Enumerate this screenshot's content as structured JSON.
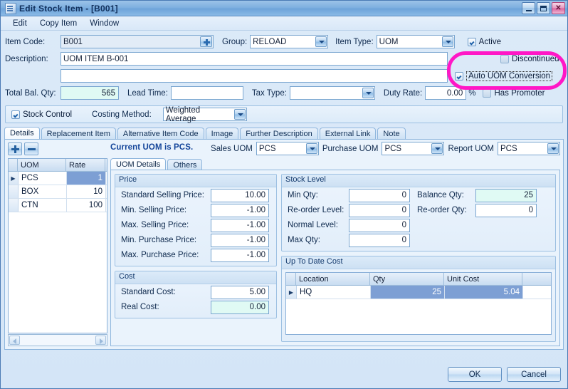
{
  "window": {
    "title": "Edit Stock Item - [B001]",
    "icon": "stock-item-icon",
    "minimize": "–",
    "maximize": "□",
    "close": "✕"
  },
  "menu": {
    "items": [
      "Edit",
      "Copy Item",
      "Window"
    ]
  },
  "header": {
    "item_code_label": "Item Code:",
    "item_code_value": "B001",
    "group_label": "Group:",
    "group_value": "RELOAD",
    "item_type_label": "Item Type:",
    "item_type_value": "UOM",
    "active_label": "Active",
    "active_checked": true,
    "description_label": "Description:",
    "description_value": "UOM ITEM B-001",
    "description2_value": "",
    "discontinued_label": "Discontinued",
    "discontinued_checked": false,
    "auto_uom_label": "Auto UOM Conversion",
    "auto_uom_checked": true,
    "has_promoter_label": "Has Promoter",
    "has_promoter_checked": false,
    "total_bal_label": "Total Bal. Qty:",
    "total_bal_value": "565",
    "lead_time_label": "Lead Time:",
    "lead_time_value": "",
    "tax_type_label": "Tax Type:",
    "tax_type_value": "",
    "duty_rate_label": "Duty Rate:",
    "duty_rate_value": "0.00",
    "duty_rate_suffix": "%",
    "stock_control_label": "Stock Control",
    "stock_control_checked": true,
    "costing_method_label": "Costing Method:",
    "costing_method_value": "Weighted Average"
  },
  "tabs": [
    {
      "label": "Details",
      "active": true
    },
    {
      "label": "Replacement Item",
      "active": false
    },
    {
      "label": "Alternative Item Code",
      "active": false
    },
    {
      "label": "Image",
      "active": false
    },
    {
      "label": "Further Description",
      "active": false
    },
    {
      "label": "External Link",
      "active": false
    },
    {
      "label": "Note",
      "active": false
    }
  ],
  "details": {
    "add_button": "add-uom",
    "remove_button": "remove-uom",
    "current_uom_text": "Current UOM is PCS.",
    "sales_uom_label": "Sales UOM",
    "sales_uom_value": "PCS",
    "purchase_uom_label": "Purchase UOM",
    "purchase_uom_value": "PCS",
    "report_uom_label": "Report UOM",
    "report_uom_value": "PCS",
    "uom_grid": {
      "columns": [
        "UOM",
        "Rate"
      ],
      "rows": [
        {
          "uom": "PCS",
          "rate": "1",
          "selected": true
        },
        {
          "uom": "BOX",
          "rate": "10",
          "selected": false
        },
        {
          "uom": "CTN",
          "rate": "100",
          "selected": false
        }
      ]
    },
    "subtabs": [
      {
        "label": "UOM Details",
        "active": true
      },
      {
        "label": "Others",
        "active": false
      }
    ],
    "price": {
      "title": "Price",
      "fields": [
        {
          "label": "Standard Selling Price:",
          "value": "10.00"
        },
        {
          "label": "Min. Selling Price:",
          "value": "-1.00"
        },
        {
          "label": "Max. Selling Price:",
          "value": "-1.00"
        },
        {
          "label": "Min. Purchase Price:",
          "value": "-1.00"
        },
        {
          "label": "Max. Purchase Price:",
          "value": "-1.00"
        }
      ]
    },
    "cost": {
      "title": "Cost",
      "fields": [
        {
          "label": "Standard Cost:",
          "value": "5.00",
          "readonly": false
        },
        {
          "label": "Real Cost:",
          "value": "0.00",
          "readonly": true
        }
      ]
    },
    "stock_level": {
      "title": "Stock Level",
      "min_qty_label": "Min Qty:",
      "min_qty_value": "0",
      "reorder_level_label": "Re-order Level:",
      "reorder_level_value": "0",
      "normal_level_label": "Normal Level:",
      "normal_level_value": "0",
      "max_qty_label": "Max Qty:",
      "max_qty_value": "0",
      "balance_qty_label": "Balance Qty:",
      "balance_qty_value": "25",
      "reorder_qty_label": "Re-order Qty:",
      "reorder_qty_value": "0"
    },
    "up_to_date_cost": {
      "title": "Up To Date Cost",
      "columns": [
        "Location",
        "Qty",
        "Unit Cost"
      ],
      "rows": [
        {
          "location": "HQ",
          "qty": "25",
          "unit_cost": "5.04",
          "selected": true
        }
      ]
    }
  },
  "footer": {
    "ok_label": "OK",
    "cancel_label": "Cancel"
  },
  "annotation": {
    "color": "#ff17c6",
    "shape": "rounded-rect-highlight"
  }
}
